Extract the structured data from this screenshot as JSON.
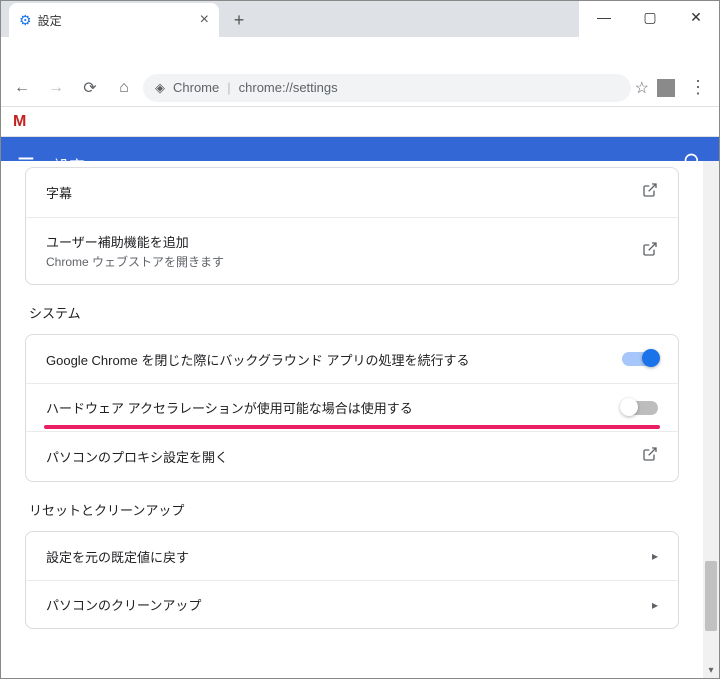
{
  "window": {
    "tab_title": "設定",
    "minimize": "—",
    "maximize": "▢",
    "close": "✕",
    "newtab": "+"
  },
  "toolbar": {
    "chrome_label": "Chrome",
    "url": "chrome://settings"
  },
  "bookmarks": {
    "gmail_letter": "M"
  },
  "header": {
    "title": "設定"
  },
  "accessibility_card": {
    "row1_label": "字幕",
    "row2_label": "ユーザー補助機能を追加",
    "row2_sub": "Chrome ウェブストアを開きます"
  },
  "system": {
    "section_title": "システム",
    "bg_apps_label": "Google Chrome を閉じた際にバックグラウンド アプリの処理を続行する",
    "bg_apps_on": true,
    "hw_accel_label": "ハードウェア アクセラレーションが使用可能な場合は使用する",
    "hw_accel_on": false,
    "proxy_label": "パソコンのプロキシ設定を開く"
  },
  "reset": {
    "section_title": "リセットとクリーンアップ",
    "restore_label": "設定を元の既定値に戻す",
    "cleanup_label": "パソコンのクリーンアップ"
  }
}
